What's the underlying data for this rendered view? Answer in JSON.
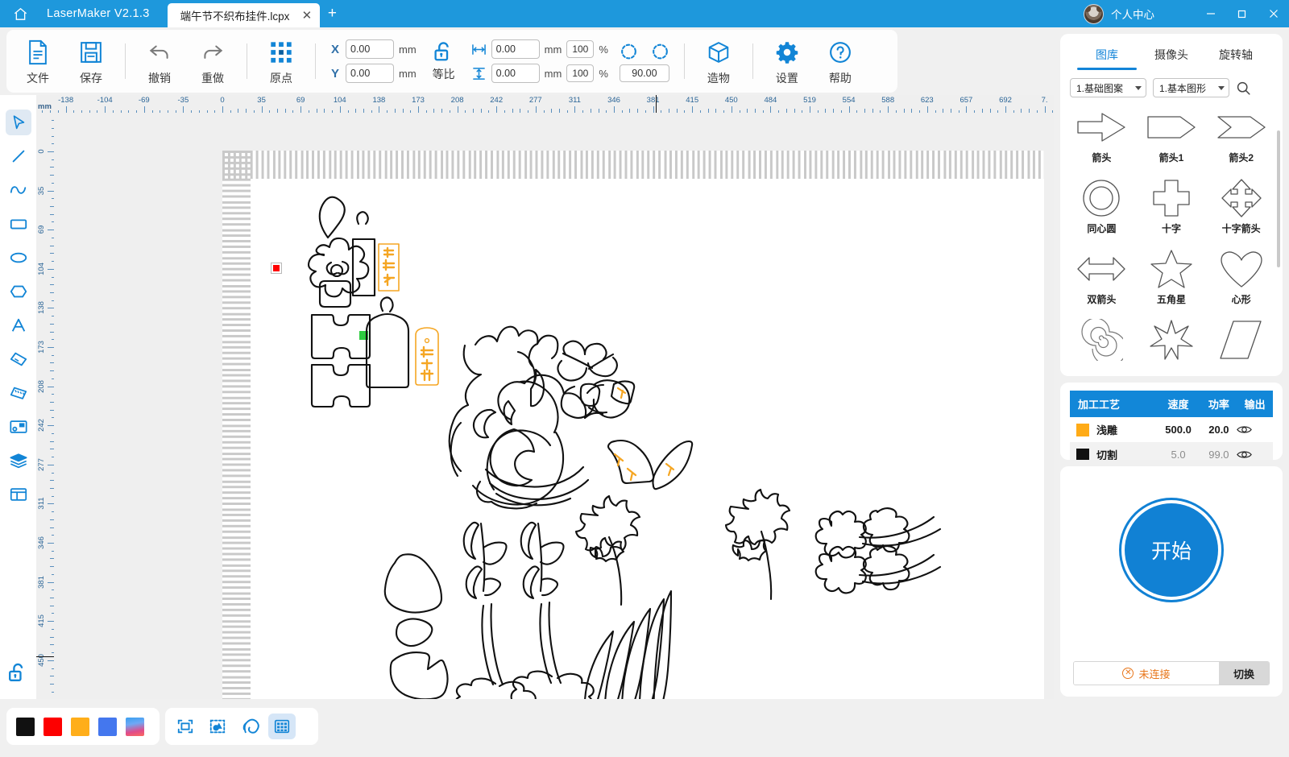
{
  "titlebar": {
    "home_icon": "home-icon",
    "app_title": "LaserMaker V2.1.3",
    "tab_label": "端午节不织布挂件.lcpx",
    "tab_close": "✕",
    "new_tab": "+",
    "user_label": "个人中心",
    "minimize": "—",
    "maximize": "❐",
    "close": "✕"
  },
  "toolbar": {
    "items": [
      {
        "label": "文件",
        "icon": "file-icon"
      },
      {
        "label": "保存",
        "icon": "save-icon"
      },
      {
        "label": "撤销",
        "icon": "undo-icon"
      },
      {
        "label": "重做",
        "icon": "redo-icon"
      },
      {
        "label": "原点",
        "icon": "origin-icon"
      }
    ],
    "right_items": [
      {
        "label": "造物",
        "icon": "box-icon"
      },
      {
        "label": "设置",
        "icon": "gear-icon"
      },
      {
        "label": "帮助",
        "icon": "help-icon"
      }
    ],
    "x_label": "X",
    "y_label": "Y",
    "x_value": "0.00",
    "y_value": "0.00",
    "mm_unit": "mm",
    "ratio_label": "等比",
    "width_value": "0.00",
    "height_value": "0.00",
    "width_pct": "100",
    "height_pct": "100",
    "pct_unit": "%",
    "angle_value": "90.00"
  },
  "rail": {
    "tools": [
      "select-arrow-icon",
      "line-icon",
      "curve-icon",
      "rectangle-icon",
      "ellipse-icon",
      "polygon-icon",
      "text-icon",
      "eraser-icon",
      "measure-icon",
      "image-icon",
      "layers-icon",
      "layout-icon"
    ],
    "lock_icon": "unlock-icon"
  },
  "rulers": {
    "unit": "mm",
    "h_labels": [
      "-138",
      "-104",
      "-69",
      "-35",
      "0",
      "35",
      "69",
      "104",
      "138",
      "173",
      "208",
      "242",
      "277",
      "311",
      "346",
      "381",
      "415",
      "450",
      "484",
      "519",
      "554",
      "588",
      "623",
      "657",
      "692",
      "7."
    ],
    "v_labels": [
      "0",
      "35",
      "69",
      "104",
      "138",
      "173",
      "208",
      "242",
      "277",
      "311",
      "346",
      "381",
      "415",
      "450"
    ]
  },
  "bottombar": {
    "swatches": [
      "#111111",
      "#fd0000",
      "#ffae1a",
      "#4477ee",
      "#5bc8f0"
    ],
    "tools": [
      {
        "name": "frame-select-icon",
        "active": false
      },
      {
        "name": "object-select-icon",
        "active": false
      },
      {
        "name": "magnet-snap-icon",
        "active": false
      },
      {
        "name": "grid-toggle-icon",
        "active": true
      }
    ]
  },
  "right_panel": {
    "tabs": [
      {
        "label": "图库",
        "active": true
      },
      {
        "label": "摄像头",
        "active": false
      },
      {
        "label": "旋转轴",
        "active": false
      }
    ],
    "category_select": "1.基础图案",
    "subcategory_select": "1.基本图形",
    "search_icon": "search-icon",
    "shapes": [
      {
        "label": "箭头",
        "icon": "arrow-block-icon"
      },
      {
        "label": "箭头1",
        "icon": "arrow-pentagon-icon"
      },
      {
        "label": "箭头2",
        "icon": "chevron-arrow-icon"
      },
      {
        "label": "同心圆",
        "icon": "concentric-circle-icon"
      },
      {
        "label": "十字",
        "icon": "cross-icon"
      },
      {
        "label": "十字箭头",
        "icon": "four-way-arrow-icon"
      },
      {
        "label": "双箭头",
        "icon": "double-arrow-icon"
      },
      {
        "label": "五角星",
        "icon": "five-point-star-icon"
      },
      {
        "label": "心形",
        "icon": "heart-icon"
      },
      {
        "label": "",
        "icon": "spiral-icon"
      },
      {
        "label": "",
        "icon": "six-point-star-icon"
      },
      {
        "label": "",
        "icon": "parallelogram-icon"
      }
    ],
    "process_table": {
      "headers": [
        "加工工艺",
        "速度",
        "功率",
        "输出"
      ],
      "rows": [
        {
          "color": "#ffab17",
          "name": "浅雕",
          "speed": "500.0",
          "power": "20.0",
          "output": "eye-icon",
          "dim": false
        },
        {
          "color": "#111111",
          "name": "切割",
          "speed": "5.0",
          "power": "99.0",
          "output": "eye-icon",
          "dim": true
        }
      ]
    },
    "start_button": "开始",
    "connection_status": "未连接",
    "switch_button": "切换"
  }
}
